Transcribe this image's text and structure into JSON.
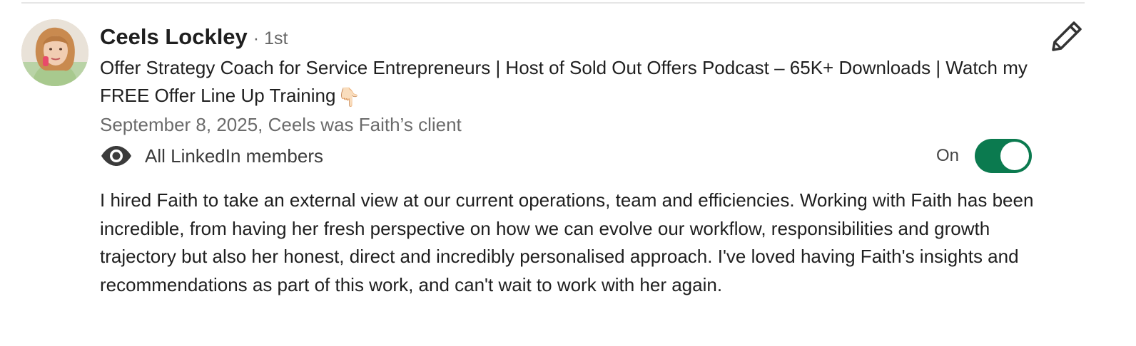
{
  "recommendation": {
    "author_name": "Ceels Lockley",
    "connection_degree": "· 1st",
    "headline": "Offer Strategy Coach for Service Entrepreneurs | Host of Sold Out Offers Podcast – 65K+ Downloads | Watch my FREE Offer Line Up Training",
    "headline_emoji": "👇🏻",
    "meta": "September 8, 2025, Ceels was Faith’s client",
    "visibility_label": "All LinkedIn members",
    "toggle_state_label": "On",
    "toggle_on": true,
    "body": "I hired Faith to take an external view at our current operations, team and efficiencies. Working with Faith has been incredible, from having her fresh perspective on how we can evolve our workflow, responsibilities and growth trajectory but also her honest, direct and incredibly personalised approach. I've loved having Faith's insights and recommendations as part of this work, and can't wait to work with her again."
  },
  "icons": {
    "edit": "pencil-icon",
    "visibility": "eye-icon"
  },
  "colors": {
    "toggle_on": "#0b7a4f",
    "muted_text": "#6b6b6b"
  }
}
